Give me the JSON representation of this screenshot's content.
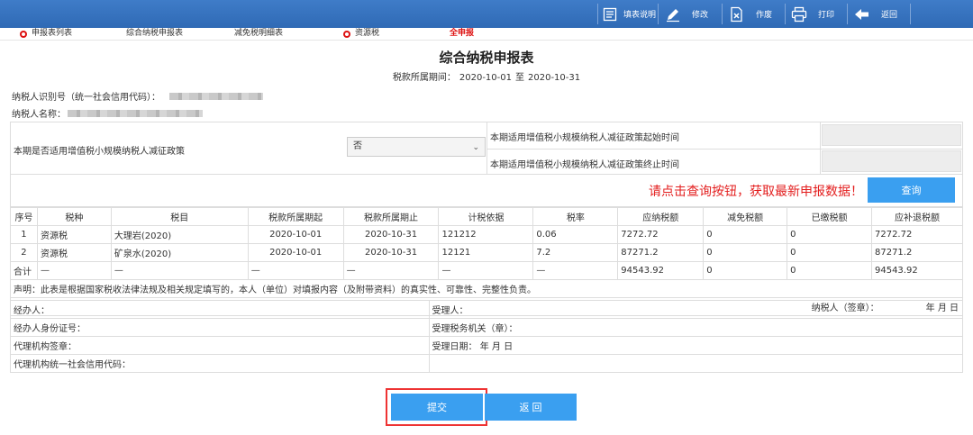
{
  "toolbar": {
    "items": [
      {
        "label": "填表说明",
        "icon": "list-icon"
      },
      {
        "label": "修改",
        "icon": "pencil-icon"
      },
      {
        "label": "作废",
        "icon": "void-doc-icon"
      },
      {
        "label": "打印",
        "icon": "printer-icon"
      },
      {
        "label": "返回",
        "icon": "back-arrow-icon"
      }
    ]
  },
  "tabs": [
    {
      "label": "申报表列表",
      "dot": true
    },
    {
      "label": "综合纳税申报表",
      "dot": false
    },
    {
      "label": "减免税明细表",
      "dot": false
    },
    {
      "label": "资源税",
      "dot": true
    },
    {
      "label": "全申报",
      "dot": false,
      "active": true
    }
  ],
  "form": {
    "title": "综合纳税申报表",
    "period_label": "税款所属期间：",
    "period_start": "2020-10-01",
    "period_to": "至",
    "period_end": "2020-10-31",
    "taxpayer_id_label": "纳税人识别号（统一社会信用代码）：",
    "taxpayer_name_label": "纳税人名称："
  },
  "policy": {
    "question": "本期是否适用增值税小规模纳税人减征政策",
    "select_value": "否",
    "start_label": "本期适用增值税小规模纳税人减征政策起始时间",
    "end_label": "本期适用增值税小规模纳税人减征政策终止时间"
  },
  "notice": {
    "text": "请点击查询按钮，获取最新申报数据！",
    "query_label": "查询"
  },
  "table": {
    "headers": [
      "序号",
      "税种",
      "税目",
      "税款所属期起",
      "税款所属期止",
      "计税依据",
      "税率",
      "应纳税额",
      "减免税额",
      "已缴税额",
      "应补退税额"
    ],
    "rows": [
      [
        "1",
        "资源税",
        "大理岩(2020)",
        "2020-10-01",
        "2020-10-31",
        "121212",
        "0.06",
        "7272.72",
        "0",
        "0",
        "7272.72"
      ],
      [
        "2",
        "资源税",
        "矿泉水(2020)",
        "2020-10-01",
        "2020-10-31",
        "12121",
        "7.2",
        "87271.2",
        "0",
        "0",
        "87271.2"
      ]
    ],
    "total": [
      "合计",
      "—",
      "—",
      "—",
      "—",
      "—",
      "—",
      "94543.92",
      "0",
      "0",
      "94543.92"
    ],
    "statement": "声明：此表是根据国家税收法律法规及相关规定填写的，本人（单位）对填报内容（及附带资料）的真实性、可靠性、完整性负责。",
    "sign_label": "纳税人（签章）：",
    "sign_date": "年  月  日"
  },
  "footer": {
    "handler": "经办人：",
    "handler_id": "经办人身份证号：",
    "agency_seal": "代理机构签章：",
    "agency_code": "代理机构统一社会信用代码：",
    "receiver": "受理人：",
    "tax_office": "受理税务机关（章）：",
    "receive_date": "受理日期：   年  月  日"
  },
  "buttons": {
    "submit": "提交",
    "back": "返 回"
  }
}
